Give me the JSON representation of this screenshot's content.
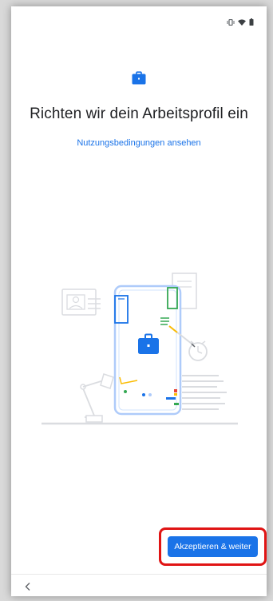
{
  "screen": {
    "title": "Richten wir dein Arbeitsprofil ein",
    "terms_link": "Nutzungsbedingungen ansehen",
    "accept_button": "Akzeptieren & weiter"
  },
  "icons": {
    "status": [
      "vibrate-icon",
      "wifi-icon",
      "battery-icon"
    ],
    "header": "briefcase-icon",
    "nav_back": "chevron-left-icon"
  },
  "colors": {
    "accent": "#1a73e8",
    "highlight_border": "#e01414",
    "title_text": "#202124"
  }
}
